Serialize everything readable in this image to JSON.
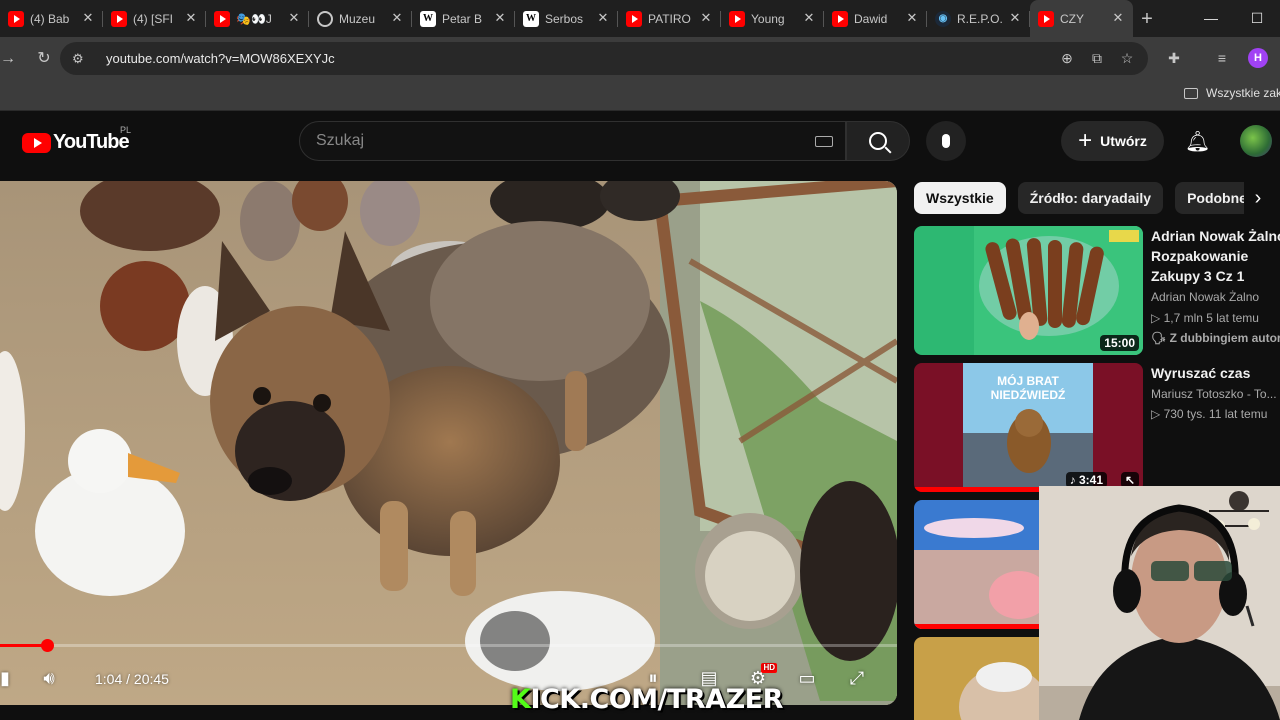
{
  "browser": {
    "tabs": [
      {
        "favicon": "youtube-icon",
        "label": "(4) Bab"
      },
      {
        "favicon": "youtube-icon",
        "label": "(4) [SFI"
      },
      {
        "favicon": "youtube-icon",
        "label": "🎭👀J"
      },
      {
        "favicon": "globe-icon",
        "label": "Muzeu"
      },
      {
        "favicon": "wikipedia-icon",
        "label": "Petar B"
      },
      {
        "favicon": "wikipedia-icon",
        "label": "Serbos"
      },
      {
        "favicon": "youtube-icon",
        "label": "PATIRO"
      },
      {
        "favicon": "youtube-icon",
        "label": "Young"
      },
      {
        "favicon": "youtube-icon",
        "label": "Dawid"
      },
      {
        "favicon": "steam-icon",
        "label": "R.E.P.O."
      },
      {
        "favicon": "youtube-icon",
        "label": "CZY",
        "active": true
      }
    ],
    "url": "youtube.com/watch?v=MOW86XEXYJc",
    "profile_initial": "H",
    "bookmarks_folder": "Wszystkie zakł"
  },
  "youtube": {
    "logo_text": "YouTube",
    "country_code": "PL",
    "search_placeholder": "Szukaj",
    "create_label": "Utwórz"
  },
  "player": {
    "time_current": "1:04",
    "time_total": "20:45",
    "time_display": "1:04 / 20:45",
    "progress": 0.052,
    "overlay_k": "K",
    "overlay_rest": "ICK.COM/TRAZER",
    "hd_badge": "HD"
  },
  "chips": [
    "Wszystkie",
    "Źródło: daryadaily",
    "Podobne"
  ],
  "recommendations": [
    {
      "title_lines": [
        "Adrian Nowak Żalno",
        "Rozpakowanie",
        "Zakupy 3 Cz 1"
      ],
      "channel": "Adrian Nowak Żalno",
      "stats": "▷ 1,7 mln  5 lat temu",
      "badge": "Z dubbingiem autor",
      "duration": "15:00"
    },
    {
      "title_lines": [
        "Wyruszać czas"
      ],
      "channel": "Mariusz Totoszko - To...",
      "stats": "▷ 730 tys.  11 lat temu",
      "duration": "3:41",
      "thumb_text_1": "MÓJ BRAT",
      "thumb_text_2": "NIEDŹWIEDŹ"
    },
    {
      "title_lines": [],
      "channel": "",
      "stats": ""
    }
  ],
  "colors": {
    "youtube_red": "#ff0000",
    "kick_green": "#53fc18",
    "background": "#0f0f0f"
  }
}
